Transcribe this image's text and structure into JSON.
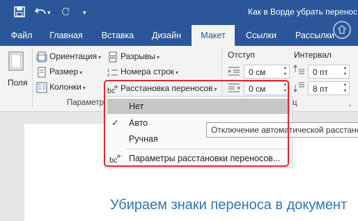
{
  "window": {
    "title": "Как в Ворде убрать перенос с"
  },
  "qat": {
    "save_icon": "save-icon",
    "undo_icon": "undo-icon",
    "redo_icon": "redo-icon",
    "customize_icon": "customize-qat-icon"
  },
  "tabs": [
    {
      "label": "Файл"
    },
    {
      "label": "Главная"
    },
    {
      "label": "Вставка"
    },
    {
      "label": "Дизайн"
    },
    {
      "label": "Макет",
      "active": true
    },
    {
      "label": "Ссылки"
    },
    {
      "label": "Рассылки"
    }
  ],
  "ribbon": {
    "margins_label": "Поля",
    "orientation_label": "Ориентация",
    "size_label": "Размер",
    "columns_label": "Колонки",
    "breaks_label": "Разрывы",
    "line_numbers_label": "Номера строк",
    "hyphenation_label": "Расстановка переносов",
    "page_setup_group": "Параметр",
    "indent_header": "Отступ",
    "indent_left": "0 см",
    "indent_right": "0 см",
    "spacing_header": "Интервал",
    "spacing_before": "0 пт",
    "spacing_after": "8 пт",
    "paragraph_group_tail": "ц"
  },
  "hyphenation_menu": {
    "items": [
      {
        "label": "Нет",
        "highlighted": true
      },
      {
        "label": "Авто",
        "checked": true
      },
      {
        "label": "Ручная"
      },
      {
        "label": "Параметры расстановки переносов..."
      }
    ]
  },
  "tooltip": {
    "text": "Отключение автоматической расстано"
  },
  "document": {
    "heading": "Убираем знаки переноса в документ"
  },
  "colors": {
    "accent": "#2b579a",
    "highlight_border": "#e0272c",
    "heading": "#2e74b5"
  }
}
